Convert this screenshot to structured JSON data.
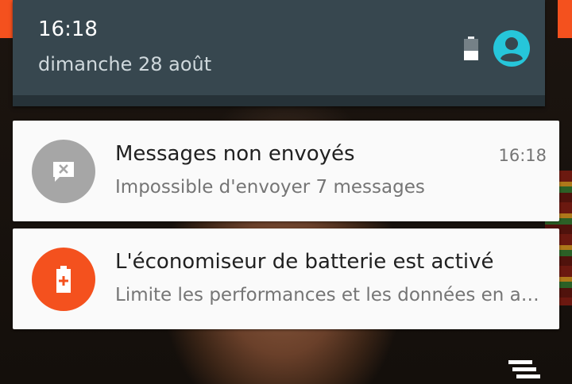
{
  "status": {
    "time": "16:18",
    "date": "dimanche 28 août",
    "icons": [
      "battery-saver-icon",
      "user-avatar-icon"
    ]
  },
  "notifications": [
    {
      "icon": "message-failed-icon",
      "title": "Messages non envoyés",
      "text": "Impossible d'envoyer 7 messages",
      "time": "16:18",
      "color": "#a6a6a6"
    },
    {
      "icon": "battery-saver-icon",
      "title": "L'économiseur de batterie est activé",
      "text": "Limite les performances et les données en arrière-plan",
      "color": "#f4511e"
    }
  ],
  "actions": {
    "clear_all_icon": "clear-all-icon"
  },
  "colors": {
    "header_bg": "#37474f",
    "accent": "#f4511e",
    "avatar": "#26c6da"
  }
}
